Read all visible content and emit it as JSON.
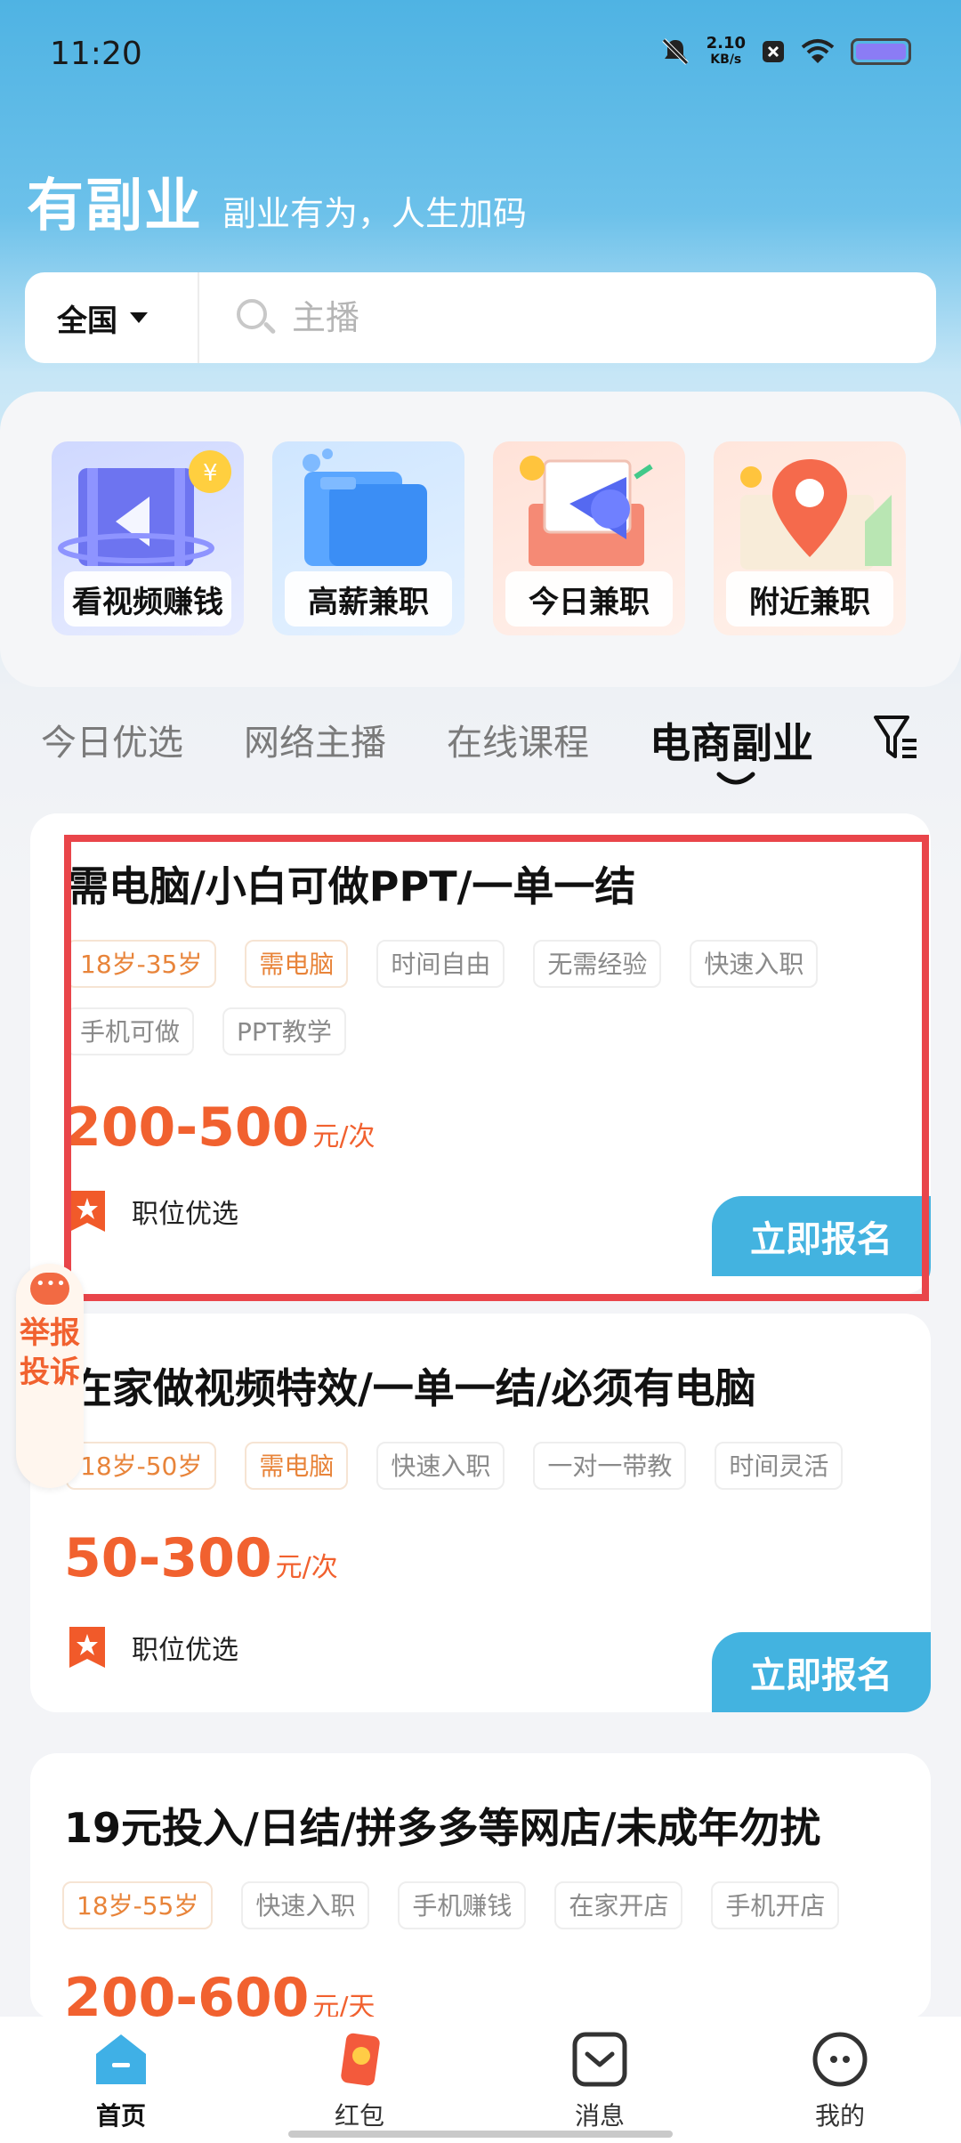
{
  "status_bar": {
    "time": "11:20",
    "speed_value": "2.10",
    "speed_unit": "KB/s",
    "icons": [
      "mute-icon",
      "close-box-icon",
      "wifi-icon",
      "battery-icon"
    ]
  },
  "header": {
    "brand": "有副业",
    "slogan": "副业有为，人生加码"
  },
  "search": {
    "region": "全国",
    "placeholder": "主播"
  },
  "categories": [
    {
      "label": "看视频赚钱",
      "icon": "video-money-icon"
    },
    {
      "label": "高薪兼职",
      "icon": "folder-icon"
    },
    {
      "label": "今日兼职",
      "icon": "megaphone-icon"
    },
    {
      "label": "附近兼职",
      "icon": "location-pin-icon"
    }
  ],
  "tabs": [
    {
      "label": "今日优选",
      "active": false
    },
    {
      "label": "网络主播",
      "active": false
    },
    {
      "label": "在线课程",
      "active": false
    },
    {
      "label": "电商副业",
      "active": true
    }
  ],
  "jobs": [
    {
      "title": "需电脑/小白可做PPT/一单一结",
      "tags_warm": [
        "18岁-35岁",
        "需电脑"
      ],
      "tags": [
        "时间自由",
        "无需经验",
        "快速入职",
        "手机可做",
        "PPT教学"
      ],
      "salary": "200-500",
      "unit": "元/次",
      "badge": "职位优选",
      "apply": "立即报名"
    },
    {
      "title": "在家做视频特效/一单一结/必须有电脑",
      "tags_warm": [
        "18岁-50岁",
        "需电脑"
      ],
      "tags": [
        "快速入职",
        "一对一带教",
        "时间灵活"
      ],
      "salary": "50-300",
      "unit": "元/次",
      "badge": "职位优选",
      "apply": "立即报名"
    },
    {
      "title": "19元投入/日结/拼多多等网店/未成年勿扰",
      "tags_warm": [
        "18岁-55岁"
      ],
      "tags": [
        "快速入职",
        "手机赚钱",
        "在家开店",
        "手机开店"
      ],
      "salary": "200-600",
      "unit": "元/天"
    }
  ],
  "report": {
    "text": "举报投诉"
  },
  "bottom_nav": [
    {
      "label": "首页",
      "icon": "home-icon",
      "active": true
    },
    {
      "label": "红包",
      "icon": "red-packet-icon",
      "active": false
    },
    {
      "label": "消息",
      "icon": "message-icon",
      "active": false
    },
    {
      "label": "我的",
      "icon": "profile-icon",
      "active": false
    }
  ],
  "colors": {
    "accent_blue": "#43b3e0",
    "salary_orange": "#f1612f",
    "highlight_red": "#e9454a"
  }
}
